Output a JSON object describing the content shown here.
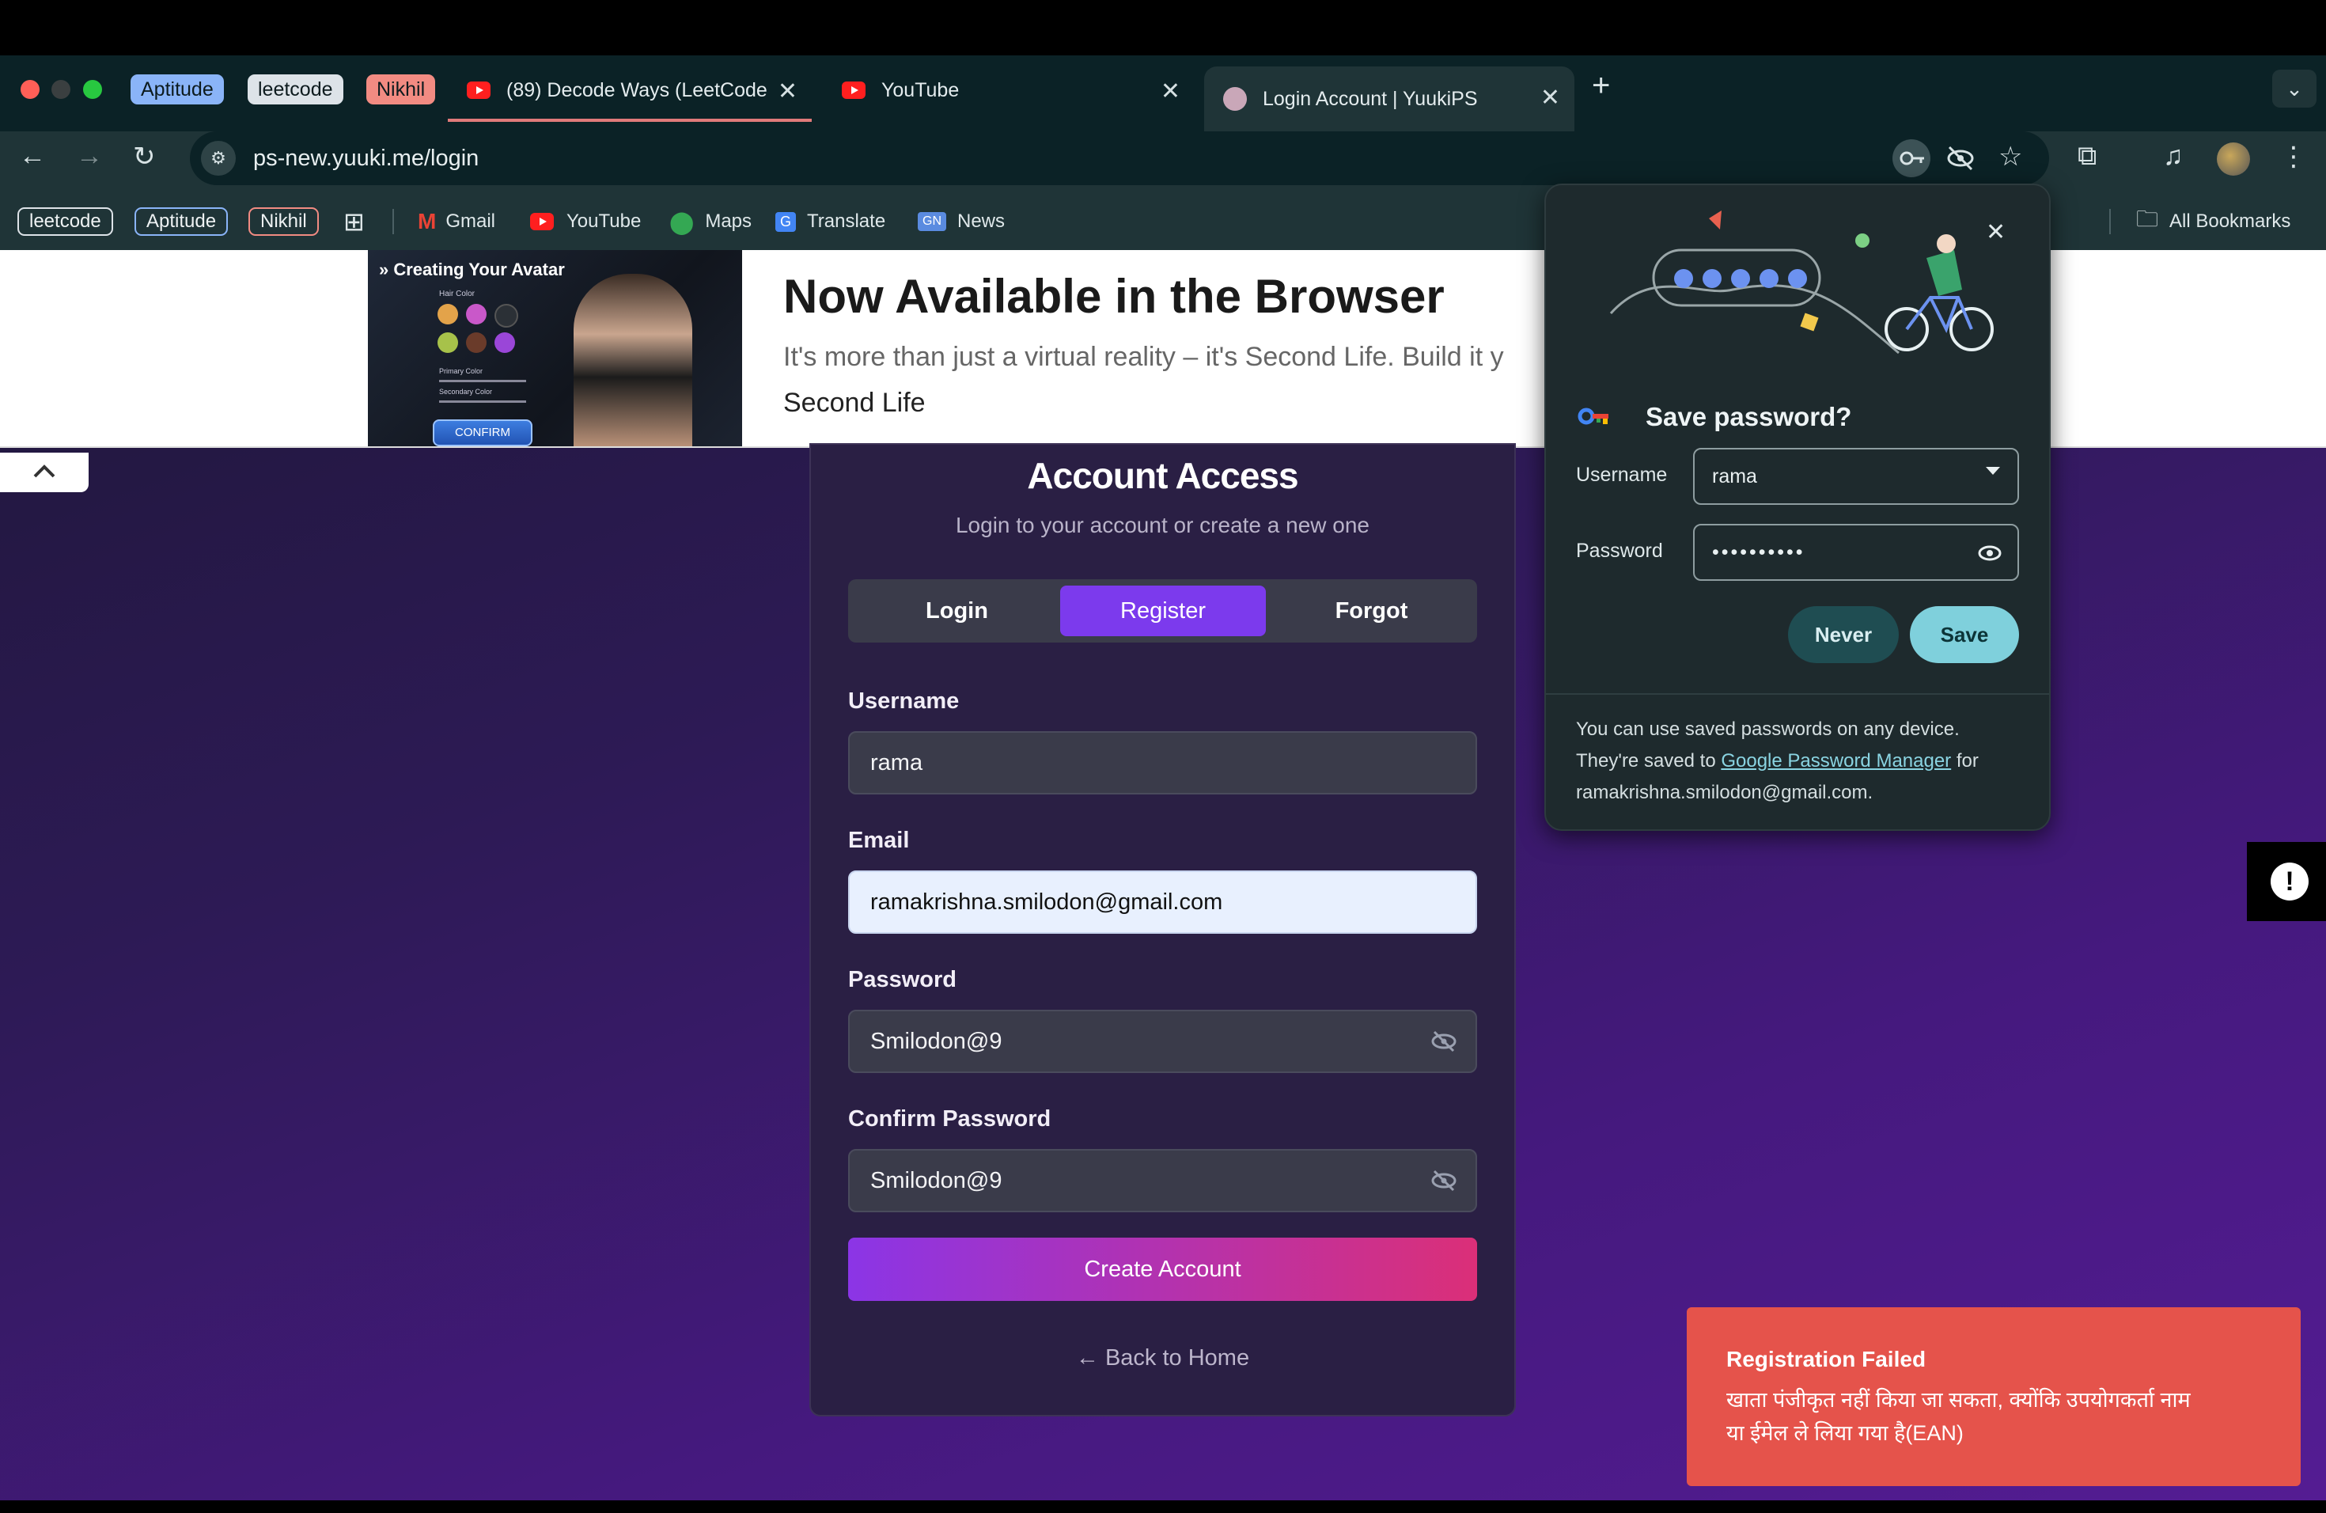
{
  "tab_groups": [
    {
      "label": "Aptitude",
      "color": "#8ab4f8"
    },
    {
      "label": "leetcode",
      "color": "#dde3e8"
    },
    {
      "label": "Nikhil",
      "color": "#f28b82"
    }
  ],
  "tabs": [
    {
      "title": "(89) Decode Ways (LeetCode",
      "close": "✕"
    },
    {
      "title": "YouTube",
      "close": "✕"
    },
    {
      "title": "Login Account | YuukiPS",
      "close": "✕"
    }
  ],
  "new_tab": "+",
  "address": "ps-new.yuuki.me/login",
  "bookmarks": {
    "groups": [
      {
        "label": "leetcode",
        "color": "#dde3e8"
      },
      {
        "label": "Aptitude",
        "color": "#8ab4f8"
      },
      {
        "label": "Nikhil",
        "color": "#f28b82"
      }
    ],
    "items": [
      "Gmail",
      "YouTube",
      "Maps",
      "Translate",
      "News"
    ],
    "all": "All Bookmarks"
  },
  "banner": {
    "image_title": "Creating Your Avatar",
    "image_labels": [
      "Hair Color",
      "Primary Color",
      "Secondary Color"
    ],
    "image_button": "CONFIRM",
    "headline": "Now Available in the Browser",
    "text": "It's more than just a virtual reality – it's Second Life. Build it y",
    "brand": "Second Life"
  },
  "card": {
    "title": "Account Access",
    "subtitle": "Login to your account or create a new one",
    "tabs": [
      "Login",
      "Register",
      "Forgot"
    ],
    "active_tab": "Register",
    "username_label": "Username",
    "username_value": "rama",
    "email_label": "Email",
    "email_value": "ramakrishna.smilodon@gmail.com",
    "password_label": "Password",
    "password_value": "Smilodon@9",
    "confirm_label": "Confirm Password",
    "confirm_value": "Smilodon@9",
    "submit": "Create Account",
    "back": "← Back to Home"
  },
  "save_password": {
    "title": "Save password?",
    "username_label": "Username",
    "username_value": "rama",
    "password_label": "Password",
    "password_value": "••••••••••",
    "never": "Never",
    "save": "Save",
    "footer_1": "You can use saved passwords on any device.",
    "footer_2": "They're saved to",
    "footer_link": "Google Password Manager",
    "footer_3": "for",
    "footer_4": "ramakrishna.smilodon@gmail.com."
  },
  "toast": {
    "title": "Registration Failed",
    "message_1": "खाता पंजीकृत नहीं किया जा सकता, क्योंकि उपयोगकर्ता नाम",
    "message_2": "या ईमेल ले लिया गया है(EAN)"
  },
  "colors": {
    "accent": "#7c3aed",
    "gradient_end": "#db2777",
    "toast": "#e5534b",
    "popup_save": "#7fd0dc"
  }
}
